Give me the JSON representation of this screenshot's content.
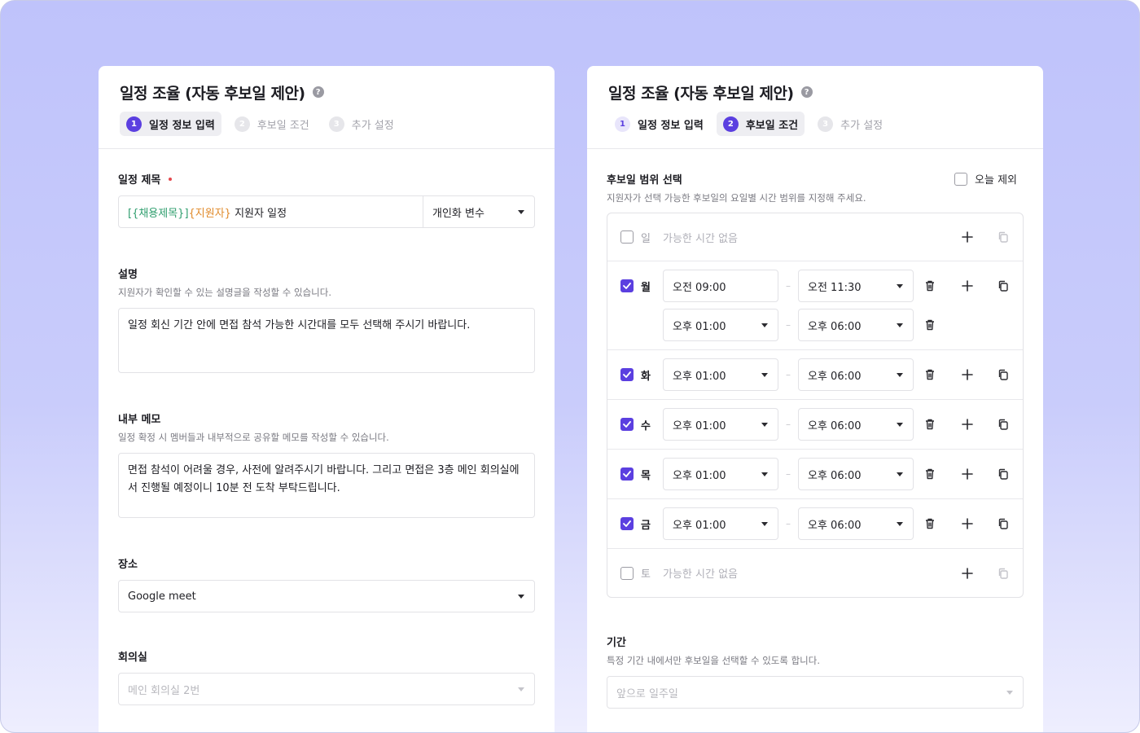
{
  "left": {
    "title": "일정 조율 (자동 후보일 제안)",
    "steps": [
      {
        "num": "1",
        "label": "일정 정보 입력"
      },
      {
        "num": "2",
        "label": "후보일 조건"
      },
      {
        "num": "3",
        "label": "추가 설정"
      }
    ],
    "schedule_title": {
      "label": "일정 제목",
      "var1": "[{채용제목}]",
      "var2": "{지원자}",
      "text": " 지원자 일정",
      "var_select": "개인화 변수"
    },
    "description": {
      "label": "설명",
      "hint": "지원자가 확인할 수 있는 설명글을 작성할 수 있습니다.",
      "value": "일정 회신 기간 안에 면접 참석 가능한 시간대를 모두 선택해 주시기 바랍니다."
    },
    "memo": {
      "label": "내부 메모",
      "hint": "일정 확정 시 멤버들과 내부적으로 공유할 메모를 작성할 수 있습니다.",
      "value": "면접 참석이 어려울 경우, 사전에 알려주시기 바랍니다. 그리고 면접은 3층 메인 회의실에서 진행될 예정이니 10분 전 도착 부탁드립니다."
    },
    "place": {
      "label": "장소",
      "value": "Google meet"
    },
    "room": {
      "label": "회의실",
      "value": "메인 회의실 2번"
    }
  },
  "right": {
    "title": "일정 조율 (자동 후보일 제안)",
    "steps": [
      {
        "num": "1",
        "label": "일정 정보 입력"
      },
      {
        "num": "2",
        "label": "후보일 조건"
      },
      {
        "num": "3",
        "label": "추가 설정"
      }
    ],
    "range": {
      "label": "후보일 범위 선택",
      "hint": "지원자가 선택 가능한 후보일의 요일별 시간 범위를 지정해 주세요.",
      "exclude_today": "오늘 제외",
      "empty_text": "가능한 시간 없음",
      "days": {
        "sun": {
          "name": "일"
        },
        "mon": {
          "name": "월",
          "slots": [
            [
              "오전 09:00",
              "오전 11:30"
            ],
            [
              "오후 01:00",
              "오후 06:00"
            ]
          ]
        },
        "tue": {
          "name": "화",
          "slots": [
            [
              "오후 01:00",
              "오후 06:00"
            ]
          ]
        },
        "wed": {
          "name": "수",
          "slots": [
            [
              "오후 01:00",
              "오후 06:00"
            ]
          ]
        },
        "thu": {
          "name": "목",
          "slots": [
            [
              "오후 01:00",
              "오후 06:00"
            ]
          ]
        },
        "fri": {
          "name": "금",
          "slots": [
            [
              "오후 01:00",
              "오후 06:00"
            ]
          ]
        },
        "sat": {
          "name": "토"
        }
      }
    },
    "period": {
      "label": "기간",
      "hint": "특정 기간 내에서만 후보일을 선택할 수 있도록 합니다.",
      "value": "앞으로 일주일"
    }
  },
  "colors": {
    "accent": "#5b3fe0",
    "required": "#e5484d"
  }
}
